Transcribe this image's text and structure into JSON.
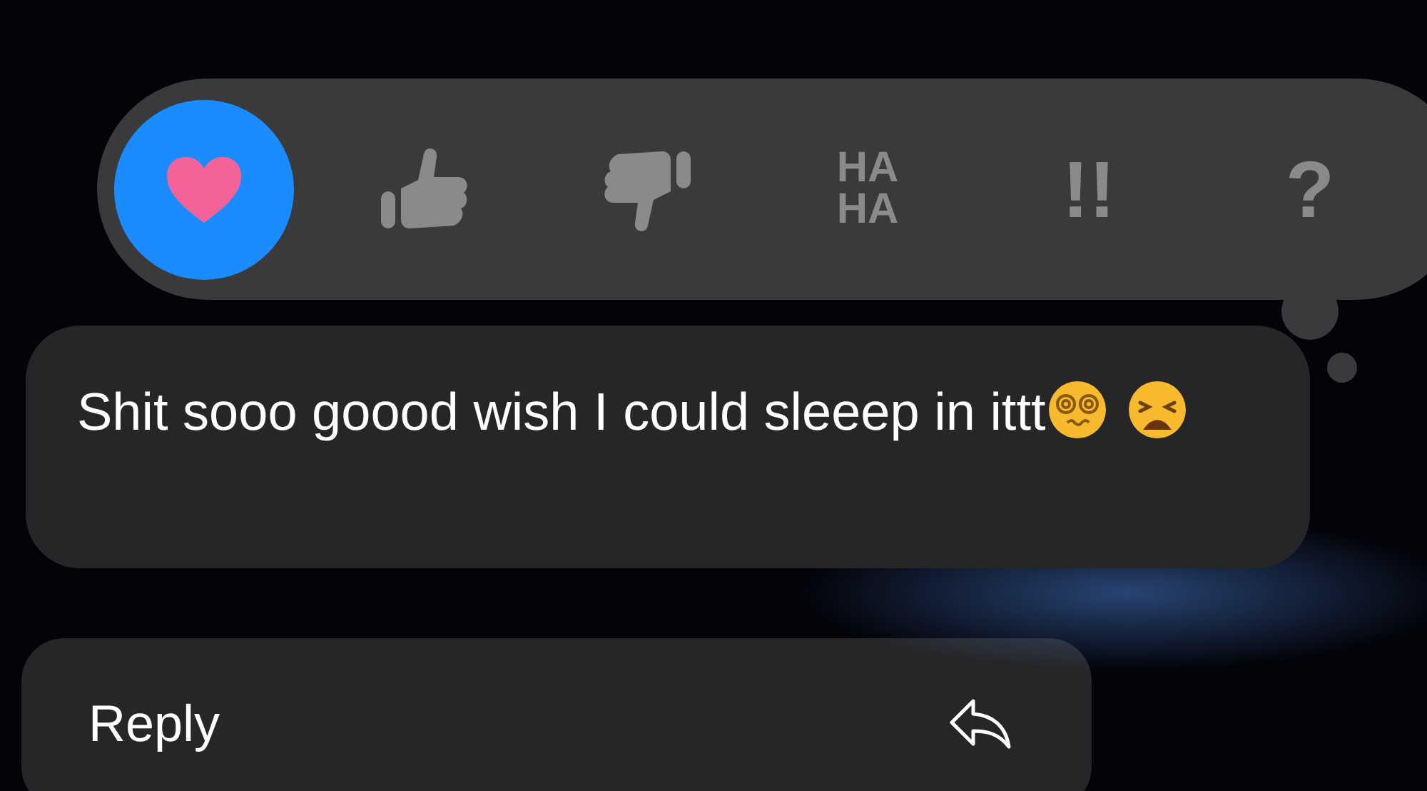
{
  "reactions": [
    {
      "kind": "heart",
      "selected": true
    },
    {
      "kind": "thumbs-up",
      "selected": false
    },
    {
      "kind": "thumbs-down",
      "selected": false
    },
    {
      "kind": "text",
      "lines": [
        "HA",
        "HA"
      ],
      "selected": false
    },
    {
      "kind": "text",
      "lines": [
        "!!"
      ],
      "selected": false
    },
    {
      "kind": "text",
      "lines": [
        "?"
      ],
      "selected": false
    }
  ],
  "message": {
    "text": "Shit sooo goood wish I could sleeep in ittt",
    "emojis": [
      {
        "kind": "dizzy"
      },
      {
        "kind": "weary"
      }
    ]
  },
  "menu": [
    {
      "label": "Reply",
      "kind": "reply"
    }
  ]
}
